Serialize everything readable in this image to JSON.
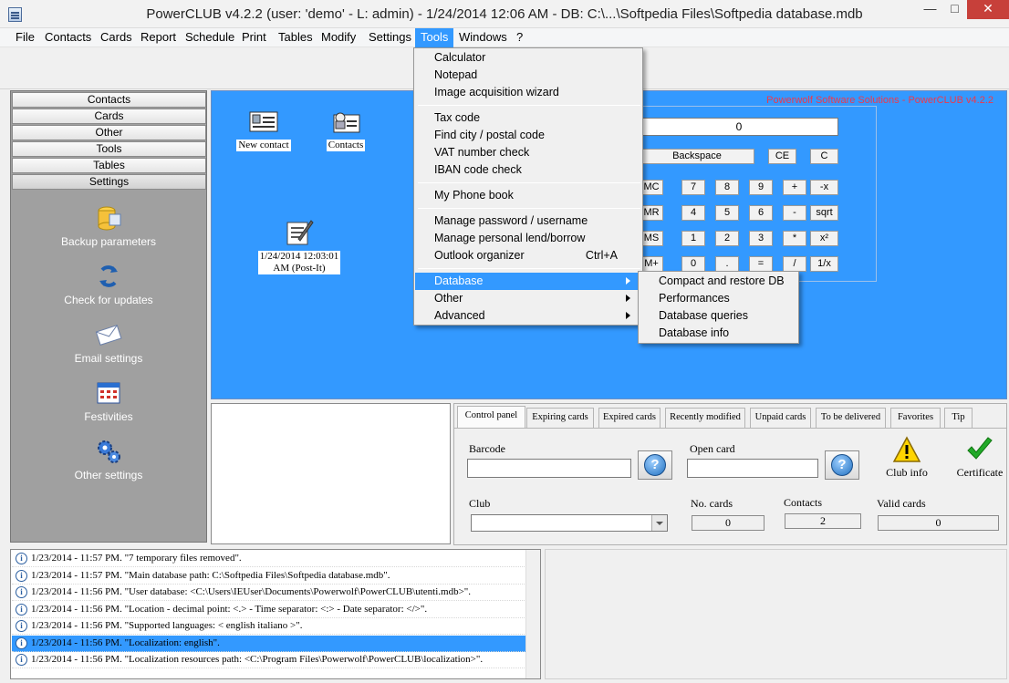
{
  "window": {
    "title": "PowerCLUB v4.2.2  (user: 'demo'  - L: admin) - 1/24/2014 12:06 AM - DB: C:\\...\\Softpedia Files\\Softpedia database.mdb",
    "minimize": "—",
    "maximize": "□",
    "close": "✕"
  },
  "menubar": [
    "File",
    "Contacts",
    "Cards",
    "Report",
    "Schedule",
    "Print",
    "Tables",
    "Modify",
    "Settings",
    "Tools",
    "Windows",
    "?"
  ],
  "leftnav": {
    "buttons": [
      "Contacts",
      "Cards",
      "Other",
      "Tools",
      "Tables",
      "Settings"
    ],
    "items": [
      {
        "label": "Backup parameters",
        "icon": "database-icon"
      },
      {
        "label": "Check for updates",
        "icon": "refresh-icon"
      },
      {
        "label": "Email settings",
        "icon": "envelope-icon"
      },
      {
        "label": "Festivities",
        "icon": "calendar-icon"
      },
      {
        "label": "Other settings",
        "icon": "gears-icon"
      }
    ]
  },
  "desktop": {
    "brand": "Powerwolf Software Solutions - PowerCLUB v4.2.2",
    "icons": [
      {
        "label": "New contact",
        "icon": "contact-card-icon"
      },
      {
        "label": "Contacts",
        "icon": "contacts-icon"
      }
    ],
    "postit": {
      "label_line1": "1/24/2014 12:03:01",
      "label_line2": "AM (Post-It)",
      "icon": "note-pen-icon"
    }
  },
  "calculator": {
    "display": "0",
    "backspace": "Backspace",
    "ce": "CE",
    "c": "C",
    "rows": [
      [
        "MC",
        "7",
        "8",
        "9",
        "+",
        "-x"
      ],
      [
        "MR",
        "4",
        "5",
        "6",
        "-",
        "sqrt"
      ],
      [
        "MS",
        "1",
        "2",
        "3",
        "*",
        "x²"
      ],
      [
        "M+",
        "0",
        ".",
        "=",
        "/",
        "1/x"
      ]
    ]
  },
  "tools_menu": {
    "items": [
      "Calculator",
      "Notepad",
      "Image acquisition wizard",
      "Tax code",
      "Find city / postal code",
      "VAT number check",
      "IBAN code check",
      "My Phone book",
      "Manage password / username",
      "Manage personal lend/borrow",
      "Outlook organizer",
      "Database",
      "Other",
      "Advanced"
    ],
    "shortcut_outlook": "Ctrl+A"
  },
  "database_submenu": [
    "Compact and restore DB",
    "Performances",
    "Database queries",
    "Database info"
  ],
  "tabs": [
    "Control panel",
    "Expiring cards",
    "Expired cards",
    "Recently modified",
    "Unpaid cards",
    "To be delivered",
    "Favorites",
    "Tip"
  ],
  "control_panel": {
    "barcode_label": "Barcode",
    "barcode_value": "",
    "open_card_label": "Open card",
    "open_card_value": "",
    "club_info_label": "Club info",
    "certificate_label": "Certificate",
    "club_label": "Club",
    "club_value": "",
    "no_cards_label": "No. cards",
    "no_cards_value": "0",
    "contacts_label": "Contacts",
    "contacts_value": "2",
    "valid_cards_label": "Valid cards",
    "valid_cards_value": "0"
  },
  "log": [
    "1/23/2014 - 11:57 PM. \"7 temporary files removed\".",
    "1/23/2014 - 11:57 PM. \"Main database path: C:\\Softpedia Files\\Softpedia database.mdb\".",
    "1/23/2014 - 11:56 PM. \"User database: <C:\\Users\\IEUser\\Documents\\Powerwolf\\PowerCLUB\\utenti.mdb>\".",
    "1/23/2014 - 11:56 PM. \"Location - decimal point: <.> - Time separator: <:> - Date separator: </>\".",
    "1/23/2014 - 11:56 PM. \"Supported languages: < english italiano >\".",
    "1/23/2014 - 11:56 PM. \"Localization: english\".",
    "1/23/2014 - 11:56 PM. \"Localization resources path: <C:\\Program Files\\Powerwolf\\PowerCLUB\\localization>\"."
  ],
  "log_selected_index": 5,
  "colors": {
    "desktop": "#3399ff",
    "highlight": "#3399ff",
    "nav_bg": "#a0a0a0",
    "brand_text": "#f0384a"
  }
}
